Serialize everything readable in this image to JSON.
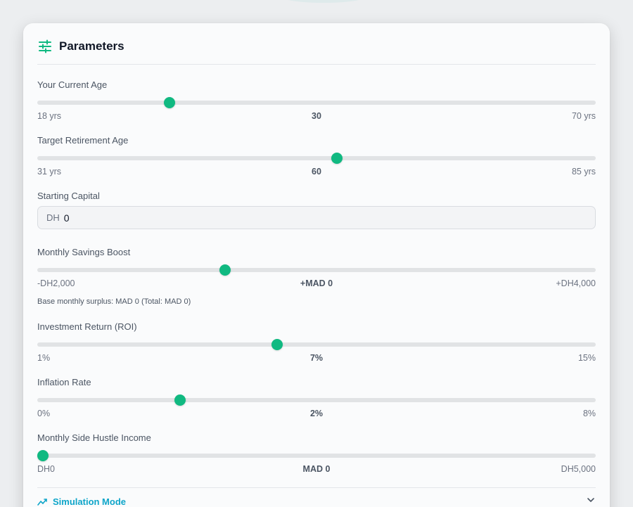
{
  "panel": {
    "title": "Parameters",
    "icon": "sliders-icon",
    "accent": "#10b981"
  },
  "current_age": {
    "label": "Your Current Age",
    "min_label": "18 yrs",
    "value_label": "30",
    "max_label": "70 yrs",
    "min": 18,
    "max": 70,
    "value": 30
  },
  "retirement_age": {
    "label": "Target Retirement Age",
    "min_label": "31 yrs",
    "value_label": "60",
    "max_label": "85 yrs",
    "min": 31,
    "max": 85,
    "value": 60
  },
  "starting_capital": {
    "label": "Starting Capital",
    "prefix": "DH",
    "value": "0"
  },
  "savings_boost": {
    "label": "Monthly Savings Boost",
    "min_label": "-DH2,000",
    "value_label": "+MAD 0",
    "max_label": "+DH4,000",
    "min": -2000,
    "max": 4000,
    "value": 0,
    "note": "Base monthly surplus: MAD 0 (Total: MAD 0)"
  },
  "roi": {
    "label": "Investment Return (ROI)",
    "min_label": "1%",
    "value_label": "7%",
    "max_label": "15%",
    "min": 1,
    "max": 15,
    "value": 7
  },
  "inflation": {
    "label": "Inflation Rate",
    "min_label": "0%",
    "value_label": "2%",
    "max_label": "8%",
    "min": 0,
    "max": 8,
    "value": 2
  },
  "side_hustle": {
    "label": "Monthly Side Hustle Income",
    "min_label": "DH0",
    "value_label": "MAD 0",
    "max_label": "DH5,000",
    "min": 0,
    "max": 5000,
    "value": 0
  },
  "footer": {
    "simulation_label": "Simulation Mode",
    "simulation_icon": "trend-line-icon",
    "simulation_color": "#0ea5c9",
    "toggle_icon": "chevron-down-icon"
  }
}
